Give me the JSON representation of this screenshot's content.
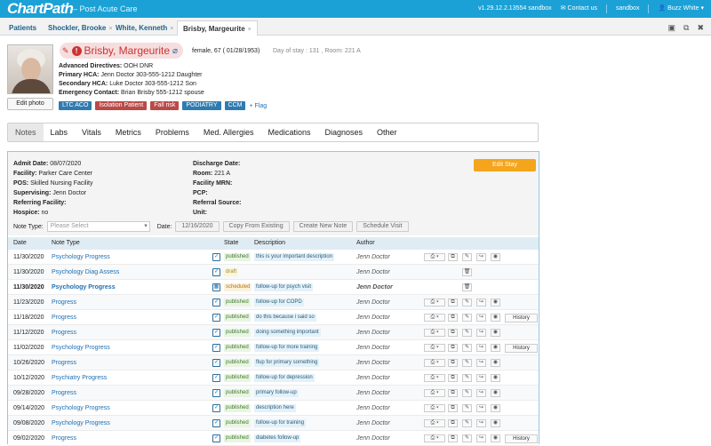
{
  "app": {
    "logo": "ChartPath",
    "subtitle": "– Post Acute Care",
    "version": "v1.29.12.2.13554 sandbox",
    "contact": "Contact us",
    "env": "sandbox",
    "user": "Buzz White"
  },
  "tabs": [
    {
      "label": "Patients"
    },
    {
      "label": "Shockler, Brooke",
      "close": "×"
    },
    {
      "label": "White, Kenneth",
      "close": "×"
    },
    {
      "label": "Brisby, Margeurite",
      "close": "×"
    }
  ],
  "patient": {
    "name": "Brisby, Margeurite",
    "demographics": "female, 67 ( 01/28/1953)",
    "stay": "Day of stay : 131 , Room: 221 A",
    "edit_photo": "Edit photo",
    "directives": [
      {
        "label": "Advanced Directives:",
        "value": "OOH DNR"
      },
      {
        "label": "Primary HCA:",
        "value": "Jenn Doctor 303-555-1212 Daughter"
      },
      {
        "label": "Secondary HCA:",
        "value": "Luke Doctor 303-555-1212 Son"
      },
      {
        "label": "Emergency Contact:",
        "value": "Brian Brisby 555-1212 spouse"
      }
    ],
    "badges": [
      {
        "label": "LTC ACO",
        "color": "#2f7bb0"
      },
      {
        "label": "Isolation Patient",
        "color": "#b94a48"
      },
      {
        "label": "Fall risk",
        "color": "#b94a48"
      },
      {
        "label": "PODIATRY",
        "color": "#2f7bb0"
      },
      {
        "label": "CCM",
        "color": "#2f7bb0"
      }
    ],
    "flag": "+ Flag"
  },
  "nav": [
    "Notes",
    "Labs",
    "Vitals",
    "Metrics",
    "Problems",
    "Med. Allergies",
    "Medications",
    "Diagnoses",
    "Other"
  ],
  "stay_info": {
    "left": [
      {
        "label": "Admit Date:",
        "value": "08/07/2020"
      },
      {
        "label": "Facility:",
        "value": "Parker Care Center"
      },
      {
        "label": "POS:",
        "value": "Skilled Nursing Facility"
      },
      {
        "label": "Supervising:",
        "value": "Jenn Doctor"
      },
      {
        "label": "Referring Facility:",
        "value": ""
      },
      {
        "label": "Hospice:",
        "value": "no"
      }
    ],
    "right": [
      {
        "label": "Discharge Date:",
        "value": ""
      },
      {
        "label": "Room:",
        "value": "221 A"
      },
      {
        "label": "Facility MRN:",
        "value": ""
      },
      {
        "label": "PCP:",
        "value": ""
      },
      {
        "label": "Referral Source:",
        "value": ""
      },
      {
        "label": "Unit:",
        "value": ""
      }
    ],
    "edit_stay": "Edit Stay"
  },
  "filter": {
    "note_type_label": "Note Type:",
    "note_type_placeholder": "Please Select",
    "date_label": "Date:",
    "date_value": "12/16/2020",
    "copy": "Copy From Existing",
    "create": "Create New Note",
    "schedule": "Schedule Visit"
  },
  "table": {
    "headers": {
      "date": "Date",
      "type": "Note Type",
      "state": "State",
      "desc": "Description",
      "author": "Author"
    },
    "history_label": "History",
    "rows": [
      {
        "date": "11/30/2020",
        "type": "Psychology Progress",
        "state": "published",
        "desc": "this is your important description",
        "author": "Jenn Doctor",
        "kind": "pub",
        "history": false
      },
      {
        "date": "11/30/2020",
        "type": "Psychology Diag Assess",
        "state": "draft",
        "desc": "",
        "author": "Jenn Doctor",
        "kind": "draft",
        "history": false
      },
      {
        "date": "11/30/2020",
        "type": "Psychology Progress",
        "state": "scheduled",
        "desc": "follow-up for psych visit",
        "author": "Jenn Doctor",
        "kind": "sched",
        "history": false
      },
      {
        "date": "11/23/2020",
        "type": "Progress",
        "state": "published",
        "desc": "follow-up for COPD",
        "author": "Jenn Doctor",
        "kind": "pub",
        "history": false
      },
      {
        "date": "11/18/2020",
        "type": "Progress",
        "state": "published",
        "desc": "do this because i said so",
        "author": "Jenn Doctor",
        "kind": "pub",
        "history": true
      },
      {
        "date": "11/12/2020",
        "type": "Progress",
        "state": "published",
        "desc": "doing something important",
        "author": "Jenn Doctor",
        "kind": "pub",
        "history": false
      },
      {
        "date": "11/02/2020",
        "type": "Psychology Progress",
        "state": "published",
        "desc": "follow-up for more training",
        "author": "Jenn Doctor",
        "kind": "pub",
        "history": true
      },
      {
        "date": "10/26/2020",
        "type": "Progress",
        "state": "published",
        "desc": "flup for primary something",
        "author": "Jenn Doctor",
        "kind": "pub",
        "history": false
      },
      {
        "date": "10/12/2020",
        "type": "Psychiatry Progress",
        "state": "published",
        "desc": "follow-up for depression",
        "author": "Jenn Doctor",
        "kind": "pub",
        "history": false
      },
      {
        "date": "09/28/2020",
        "type": "Progress",
        "state": "published",
        "desc": "primary follow-up",
        "author": "Jenn Doctor",
        "kind": "pub",
        "history": false
      },
      {
        "date": "09/14/2020",
        "type": "Psychology Progress",
        "state": "published",
        "desc": "description here",
        "author": "Jenn Doctor",
        "kind": "pub",
        "history": false
      },
      {
        "date": "09/08/2020",
        "type": "Psychology Progress",
        "state": "published",
        "desc": "follow-up for training",
        "author": "Jenn Doctor",
        "kind": "pub",
        "history": false
      },
      {
        "date": "09/02/2020",
        "type": "Progress",
        "state": "published",
        "desc": "diabetes follow-up",
        "author": "Jenn Doctor",
        "kind": "pub",
        "history": true
      }
    ]
  }
}
